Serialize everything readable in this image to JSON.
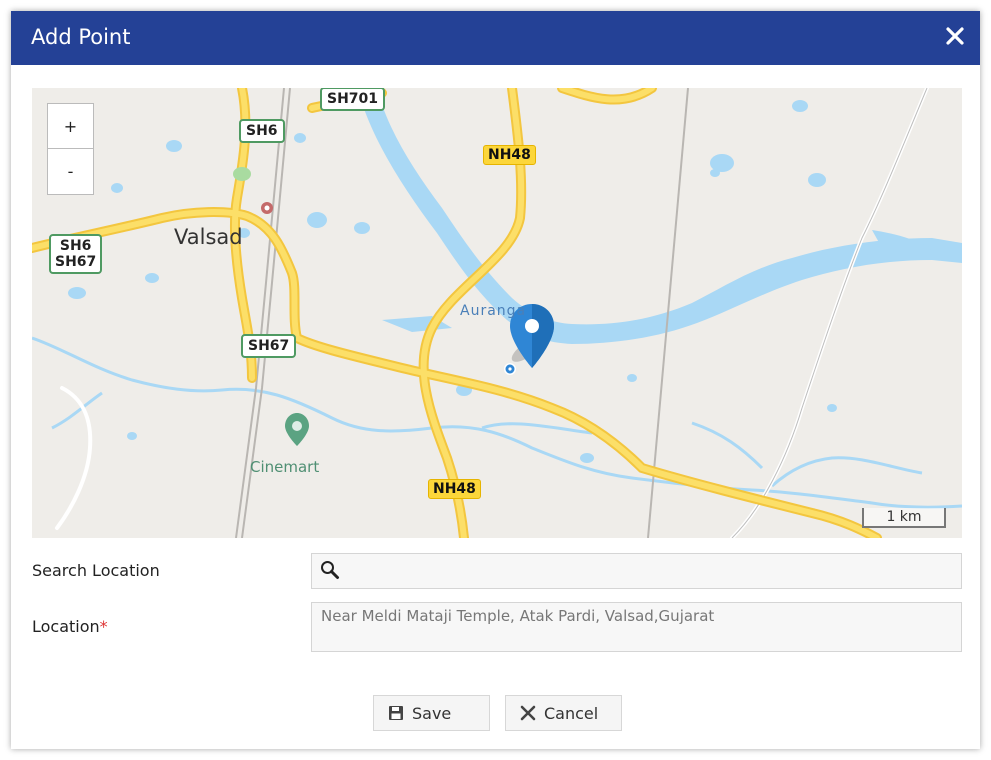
{
  "dialog": {
    "title": "Add Point"
  },
  "map": {
    "zoom_in": "+",
    "zoom_out": "-",
    "scale_label": "1 km",
    "labels": {
      "city": "Valsad",
      "aurangaa": "Auranga",
      "cinemart": "Cinemart",
      "sh701": "SH701",
      "sh6": "SH6",
      "sh6_sh67_top": "SH6",
      "sh6_sh67_bottom": "SH67",
      "sh67": "SH67",
      "nh48_top": "NH48",
      "nh48_bottom": "NH48"
    },
    "colors": {
      "land": "#efede9",
      "water": "#a9d8f5",
      "road": "#fcd63a",
      "marker": "#2f86d5"
    }
  },
  "form": {
    "search_label": "Search Location",
    "search_value": "",
    "location_label": "Location",
    "location_required": "*",
    "location_value": "Near Meldi Mataji Temple, Atak Pardi, Valsad,Gujarat"
  },
  "buttons": {
    "save": "Save",
    "cancel": "Cancel"
  },
  "colors": {
    "titlebar": "#244196"
  }
}
